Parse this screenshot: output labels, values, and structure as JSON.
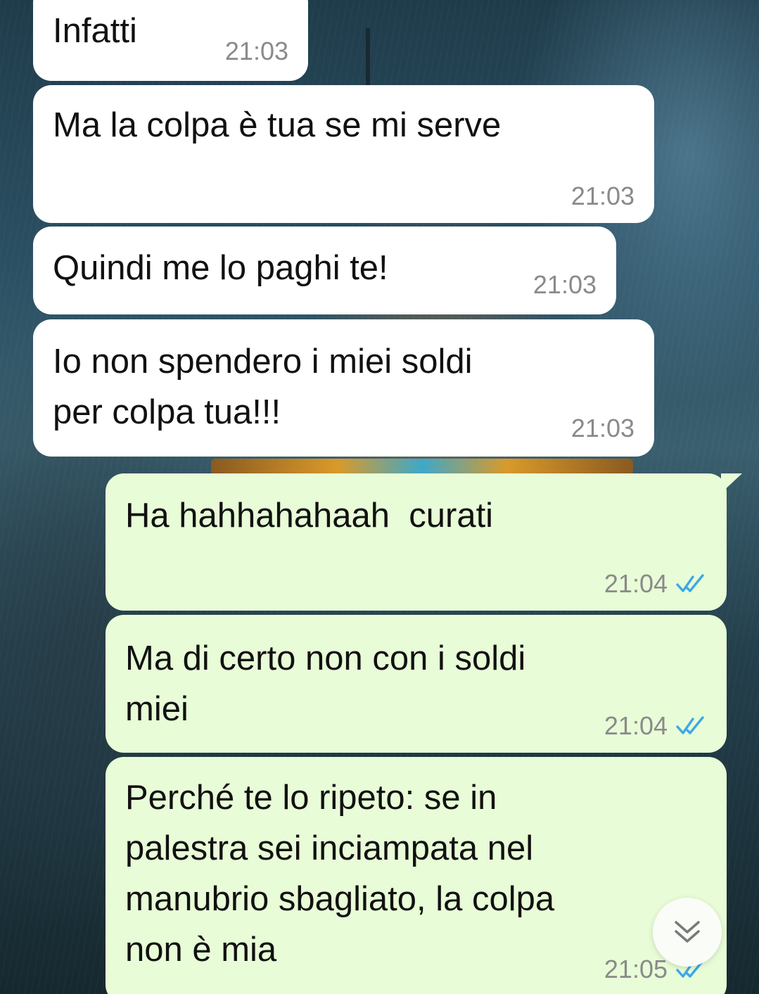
{
  "messages": [
    {
      "direction": "incoming",
      "text": "Infatti",
      "time": "21:03"
    },
    {
      "direction": "incoming",
      "text": "Ma la colpa è tua se mi serve",
      "time": "21:03"
    },
    {
      "direction": "incoming",
      "text": "Quindi me lo paghi te!",
      "time": "21:03"
    },
    {
      "direction": "incoming",
      "text": "Io non spendero i miei soldi\nper colpa tua!!!",
      "time": "21:03"
    },
    {
      "direction": "outgoing",
      "text": "Ha hahhahahaah  curati",
      "time": "21:04",
      "status": "read"
    },
    {
      "direction": "outgoing",
      "text": "Ma di certo non con i soldi\nmiei",
      "time": "21:04",
      "status": "read"
    },
    {
      "direction": "outgoing",
      "text": "Perché te lo ripeto: se in\npalestra sei inciampata nel\nmanubrio sbagliato, la colpa\nnon è mia",
      "time": "21:05",
      "status": "read"
    }
  ],
  "colors": {
    "incoming_bubble": "#ffffff",
    "outgoing_bubble": "#e8fcd7",
    "read_ticks": "#3ea8e6",
    "timestamp": "#8a8a8a"
  },
  "icons": {
    "read_receipt": "double-check-icon",
    "scroll_down": "chevron-double-down-icon"
  }
}
